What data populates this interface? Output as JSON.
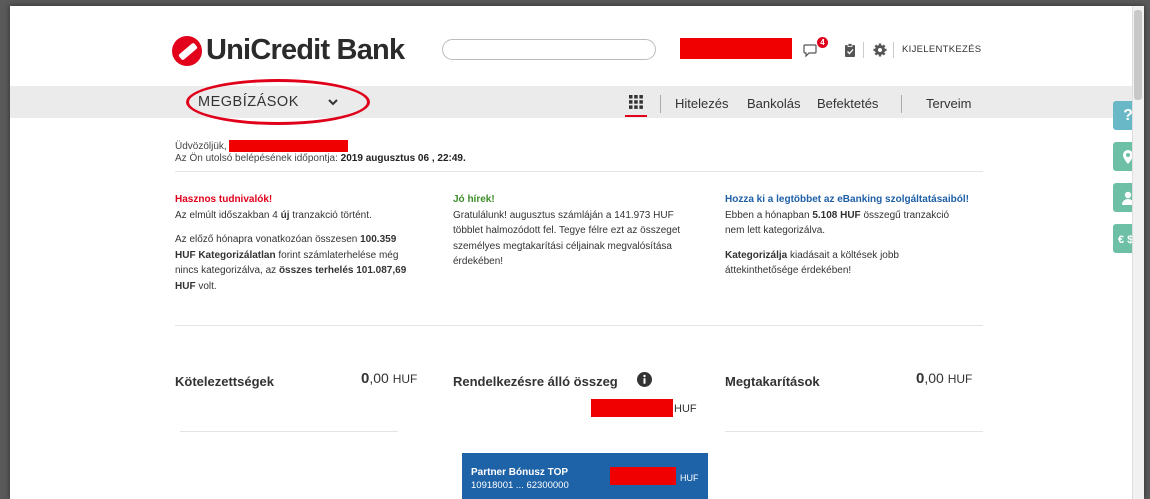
{
  "header": {
    "logo_text": "UniCredit Bank",
    "search_placeholder": "",
    "notification_count": "4",
    "logout_label": "KIJELENTKEZÉS"
  },
  "nav": {
    "menu_label": "MEGBÍZÁSOK",
    "links": [
      "Hitelezés",
      "Bankolás",
      "Befektetés",
      "Terveim"
    ]
  },
  "side_buttons": [
    "?",
    "location-pin-icon",
    "user-icon",
    "currency-exchange-icon"
  ],
  "welcome": {
    "greeting": "Üdvözöljük,",
    "last_login_label": "Az Ön utolsó belépésének időpontja:",
    "last_login_value": "2019 augusztus 06 , 22:49."
  },
  "info": {
    "useful": {
      "title": "Hasznos tudnivalók!",
      "p1_a": "Az elmúlt időszakban 4 ",
      "p1_b": "új",
      "p1_c": " tranzakció történt.",
      "p2_a": "Az előző hónapra vonatkozóan összesen ",
      "p2_b": "100.359 HUF Kategorizálatlan",
      "p2_c": " forint számlaterhelése még nincs kategorizálva, az ",
      "p2_d": "összes terhelés 101.087,69 HUF",
      "p2_e": " volt."
    },
    "good_news": {
      "title": "Jó hírek!",
      "text": "Gratulálunk! augusztus számláján a 141.973 HUF többlet halmozódott fel. Tegye félre ezt az összeget személyes megtakarítási céljainak megvalósítása érdekében!"
    },
    "ebanking": {
      "title": "Hozza ki a legtöbbet az eBanking szolgáltatásaiból!",
      "p1_a": "Ebben a hónapban ",
      "p1_b": "5.108 HUF",
      "p1_c": " összegű tranzakció nem lett kategorizálva.",
      "p2_a": "Kategorizálja",
      "p2_b": " kiadásait a költések jobb áttekinthetősége érdekében!"
    }
  },
  "summary": {
    "liabilities_label": "Kötelezettségek",
    "liabilities_int": "0",
    "liabilities_dec": ",00",
    "liabilities_cur": "HUF",
    "available_label": "Rendelkezésre álló összeg",
    "available_cur": "HUF",
    "savings_label": "Megtakarítások",
    "savings_int": "0",
    "savings_dec": ",00",
    "savings_cur": "HUF"
  },
  "account_card": {
    "name": "Partner Bónusz TOP",
    "number": "10918001 ... 62300000",
    "currency": "HUF"
  },
  "colors": {
    "brand_red": "#e2001a",
    "card_blue": "#1e63a8",
    "side_green": "#6dbfa6",
    "side_blue": "#69b8c8"
  }
}
